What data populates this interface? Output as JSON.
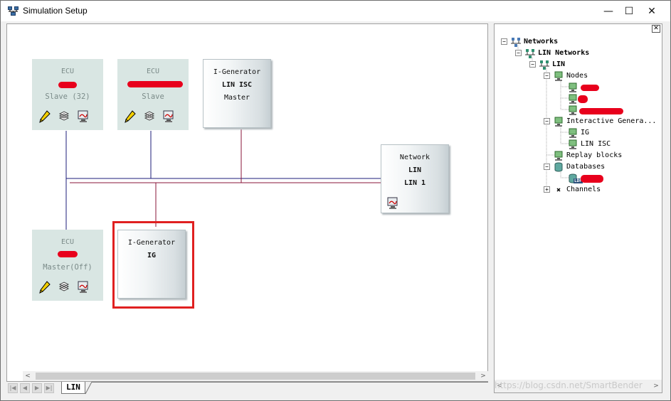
{
  "window": {
    "title": "Simulation Setup",
    "minimize_glyph": "—",
    "maximize_glyph": "☐",
    "close_glyph": "✕"
  },
  "canvas": {
    "ecus": [
      {
        "label": "ECU",
        "name": "",
        "mode": "Slave (32)"
      },
      {
        "label": "ECU",
        "name": "",
        "mode": "Slave"
      },
      {
        "label": "ECU",
        "name": "",
        "mode": "Master(Off)"
      }
    ],
    "generators": [
      {
        "type": "I-Generator",
        "name": "LIN ISC",
        "role": "Master"
      },
      {
        "type": "I-Generator",
        "name": "IG",
        "role": ""
      }
    ],
    "network": {
      "type": "Network",
      "protocol": "LIN",
      "name": "LIN 1"
    },
    "tab_label": "LIN",
    "colors": {
      "bus_blue": "#1c1c7a",
      "bus_red": "#8a1438",
      "highlight": "#e02020"
    }
  },
  "tree": {
    "close_glyph": "✕",
    "items": [
      {
        "label": "Networks",
        "expander": "−"
      },
      {
        "label": "LIN Networks",
        "expander": "−"
      },
      {
        "label": "LIN",
        "expander": "−"
      },
      {
        "label": "Nodes",
        "expander": "−"
      },
      {
        "label": ""
      },
      {
        "label": ""
      },
      {
        "label": ""
      },
      {
        "label": "Interactive Genera...",
        "expander": "−"
      },
      {
        "label": "IG"
      },
      {
        "label": "LIN ISC"
      },
      {
        "label": "Replay blocks"
      },
      {
        "label": "Databases",
        "expander": "−"
      },
      {
        "label": ""
      },
      {
        "label": "Channels",
        "expander": "+"
      }
    ],
    "ldf_badge": "LDF"
  },
  "watermark": "https://blog.csdn.net/SmartBender"
}
